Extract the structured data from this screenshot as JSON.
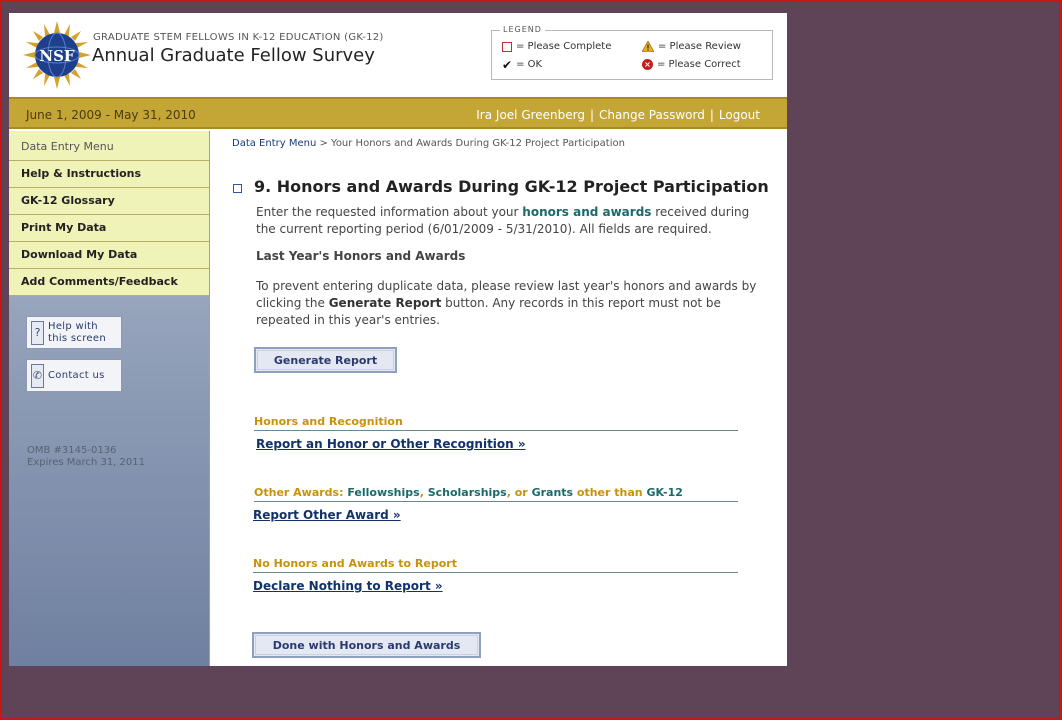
{
  "header": {
    "logo_text": "NSF",
    "program": "GRADUATE STEM FELLOWS IN K-12 EDUCATION (GK-12)",
    "title": "Annual Graduate Fellow Survey"
  },
  "legend": {
    "title": "LEGEND",
    "please_complete": "= Please Complete",
    "please_review": "= Please Review",
    "ok": "= OK",
    "please_correct": "= Please Correct"
  },
  "topbar": {
    "date_range": "June 1, 2009 - May 31, 2010",
    "user": "Ira Joel Greenberg",
    "change_password": "Change Password",
    "logout": "Logout"
  },
  "sidebar": {
    "menu_head": "Data Entry Menu",
    "items": [
      {
        "label": "Help & Instructions"
      },
      {
        "label": "GK-12 Glossary"
      },
      {
        "label": "Print My Data"
      },
      {
        "label": "Download My Data"
      },
      {
        "label": "Add Comments/Feedback"
      }
    ],
    "help_line1": "Help with",
    "help_line2": "this screen",
    "contact": "Contact us",
    "omb": "OMB #3145-0136",
    "expires": "Expires March 31, 2011"
  },
  "content": {
    "breadcrumb_link": "Data Entry Menu",
    "breadcrumb_current": " > Your Honors and Awards During GK-12 Project Participation",
    "section_title": "9. Honors and Awards During GK-12 Project Participation",
    "intro_a": "Enter the requested information about your ",
    "intro_hl": "honors and awards",
    "intro_b": " received during the current reporting period (6/01/2009 - 5/31/2010). All fields are required.",
    "last_year_title": "Last Year's Honors and Awards",
    "dup_a": "To prevent entering duplicate data, please review last year's honors and awards by clicking the ",
    "dup_bold": "Generate Report",
    "dup_b": " button. Any records in this report must not be repeated in this year's entries.",
    "generate_button": "Generate Report",
    "honors_head": "Honors and Recognition",
    "honors_link": "Report an Honor or Other Recognition »",
    "other_head_a": "Other Awards: ",
    "other_head_b": "Fellowships",
    "other_head_c": ", ",
    "other_head_d": "Scholarships",
    "other_head_e": ", or ",
    "other_head_f": "Grants",
    "other_head_g": " other than ",
    "other_head_h": "GK-12",
    "other_link": "Report Other Award »",
    "none_head": "No Honors and Awards to Report",
    "none_link": "Declare Nothing to Report »",
    "done_button": "Done with Honors and Awards"
  },
  "colors": {
    "gold_bar": "#c4a637",
    "menu_bg": "#f0f3b8",
    "group_heading": "#c8920a",
    "teal": "#1a6a6a",
    "outer_bg": "#5e4456"
  }
}
